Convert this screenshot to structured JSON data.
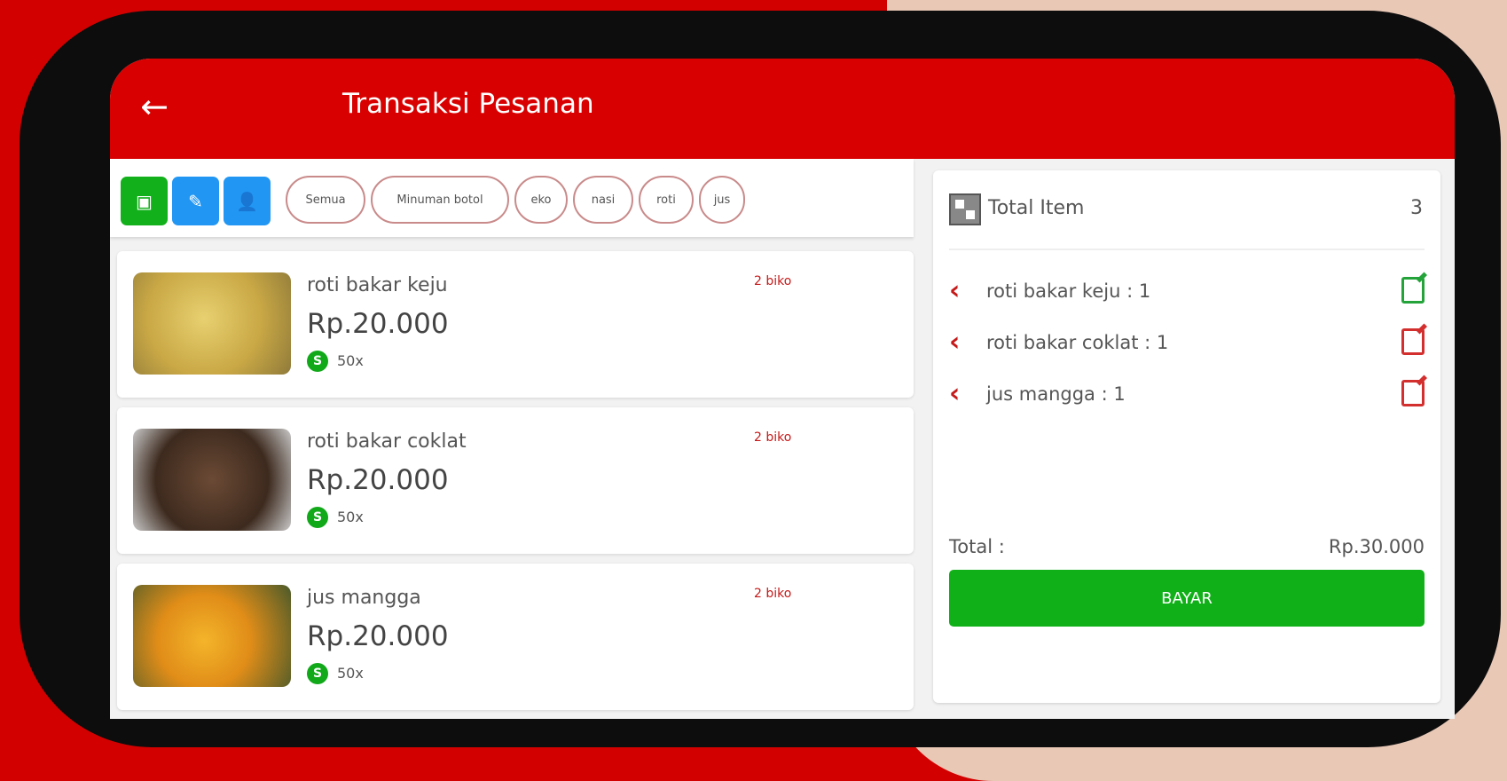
{
  "appbar": {
    "title": "Transaksi Pesanan",
    "back_icon": "arrow-left-icon"
  },
  "toolbar": {
    "buttons": [
      {
        "icon": "scan-icon",
        "color": "#12b01b"
      },
      {
        "icon": "edit-icon",
        "color": "#2196f3"
      },
      {
        "icon": "add-user-icon",
        "color": "#2196f3"
      }
    ],
    "chips": [
      "Semua",
      "Minuman botol",
      "eko",
      "nasi",
      "roti",
      "jus"
    ]
  },
  "products": [
    {
      "name": "roti bakar keju",
      "price": "Rp.20.000",
      "stock": "50x",
      "badge": "2 biko"
    },
    {
      "name": "roti bakar coklat",
      "price": "Rp.20.000",
      "stock": "50x",
      "badge": "2 biko"
    },
    {
      "name": "jus mangga",
      "price": "Rp.20.000",
      "stock": "50x",
      "badge": "2 biko"
    }
  ],
  "cart": {
    "total_item_label": "Total Item",
    "total_item_count": "3",
    "items": [
      {
        "text": "roti bakar keju : 1",
        "edit_color": "#23a33a"
      },
      {
        "text": "roti bakar coklat : 1",
        "edit_color": "#d32f2f"
      },
      {
        "text": "jus mangga : 1",
        "edit_color": "#d32f2f"
      }
    ],
    "total_label": "Total :",
    "total_value": "Rp.30.000",
    "pay_label": "BAYAR"
  },
  "colors": {
    "brand_red": "#d80000",
    "pay_green": "#10b018"
  }
}
